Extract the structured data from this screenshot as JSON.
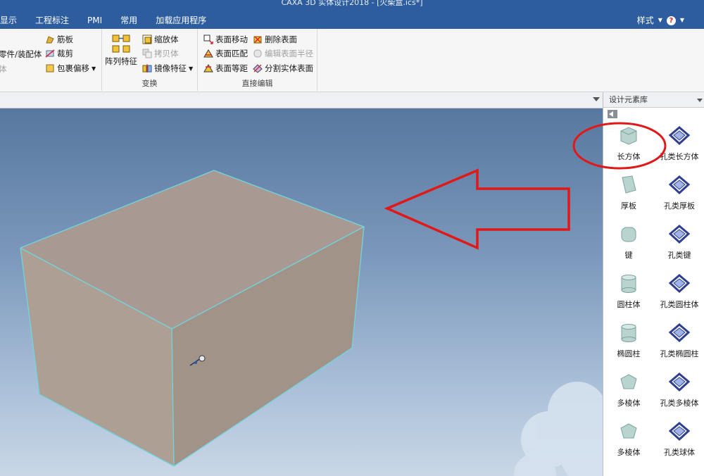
{
  "window": {
    "title": "CAXA 3D 实体设计2018 - [火柴盒.ics*]"
  },
  "menu": {
    "items": [
      "显示",
      "工程标注",
      "PMI",
      "常用",
      "加载应用程序"
    ]
  },
  "style_menu": {
    "label": "样式"
  },
  "ribbon": {
    "partial_col": {
      "item1": "零件/装配体",
      "item2": "体"
    },
    "feature_col": {
      "rib": "筋板",
      "trim": "裁剪",
      "wrap_offset": "包裹偏移"
    },
    "transform": {
      "array_feature": "阵列特征",
      "scale_body": "缩放体",
      "copy_body": "拷贝体",
      "mirror_feature": "镜像特征",
      "group_label": "变换"
    },
    "direct_edit": {
      "face_move": "表面移动",
      "face_match": "表面匹配",
      "face_offset": "表面等距",
      "delete_face": "删除表面",
      "edit_face_radius": "编辑表面半径",
      "split_solid_face": "分割实体表面",
      "group_label": "直接编辑"
    }
  },
  "panel": {
    "title": "设计元素库",
    "items": [
      {
        "label": "长方体",
        "icon": "box-icon",
        "kind": "solid"
      },
      {
        "label": "孔类长方体",
        "icon": "box-hole-icon",
        "kind": "hole"
      },
      {
        "label": "厚板",
        "icon": "thick-plate-icon",
        "kind": "solid"
      },
      {
        "label": "孔类厚板",
        "icon": "plate-hole-icon",
        "kind": "hole"
      },
      {
        "label": "键",
        "icon": "key-icon",
        "kind": "solid"
      },
      {
        "label": "孔类键",
        "icon": "key-hole-icon",
        "kind": "hole"
      },
      {
        "label": "圆柱体",
        "icon": "cylinder-icon",
        "kind": "solid"
      },
      {
        "label": "孔类圆柱体",
        "icon": "cylinder-hole-icon",
        "kind": "hole"
      },
      {
        "label": "椭圆柱",
        "icon": "elliptic-cylinder-icon",
        "kind": "solid"
      },
      {
        "label": "孔类椭圆柱",
        "icon": "elliptic-cylinder-hole-icon",
        "kind": "hole"
      },
      {
        "label": "多棱体",
        "icon": "prism-icon",
        "kind": "solid"
      },
      {
        "label": "孔类多棱体",
        "icon": "prism-hole-icon",
        "kind": "hole"
      },
      {
        "label": "多棱体",
        "icon": "prism-icon",
        "kind": "solid"
      },
      {
        "label": "孔类球体",
        "icon": "sphere-hole-icon",
        "kind": "hole"
      }
    ]
  },
  "colors": {
    "title_bar": "#2d5d9f",
    "box_top": "#a89a92",
    "box_front": "#ae9f94",
    "box_right": "#a29389",
    "box_edge": "#6fd6e0",
    "annotation_red": "#e01818"
  }
}
